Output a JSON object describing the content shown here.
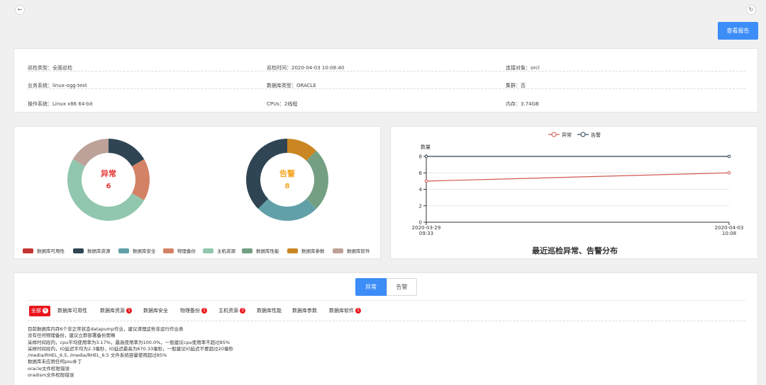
{
  "toolbar": {
    "back_icon": "arrow-left-icon",
    "refresh_icon": "refresh-icon",
    "report_button": "查看报告"
  },
  "info": {
    "rows": [
      [
        {
          "label": "巡检类型",
          "value": "全面巡检"
        },
        {
          "label": "巡检时间",
          "value": "2020-04-03 10:08:40"
        },
        {
          "label": "连接对象",
          "value": "orcl"
        }
      ],
      [
        {
          "label": "业务系统",
          "value": "linux-ogg-test"
        },
        {
          "label": "数据库类型",
          "value": "ORACLE"
        },
        {
          "label": "集群",
          "value": "否"
        }
      ],
      [
        {
          "label": "操作系统",
          "value": "Linux x86 64-bit"
        },
        {
          "label": "CPUs",
          "value": "2线程"
        },
        {
          "label": "内存",
          "value": "3.74GB"
        }
      ]
    ]
  },
  "donuts": [
    {
      "center_label": "异常",
      "center_value": "6",
      "label_color": "#e43a36",
      "segments": [
        {
          "category": "数据库资源",
          "value": 1,
          "color": "#2f4554"
        },
        {
          "category": "物理备份",
          "value": 1,
          "color": "#d48265"
        },
        {
          "category": "主机资源",
          "value": 3,
          "color": "#91c7ae"
        },
        {
          "category": "数据库软件",
          "value": 1,
          "color": "#bda29a"
        }
      ]
    },
    {
      "center_label": "告警",
      "center_value": "8",
      "label_color": "#f5a623",
      "segments": [
        {
          "category": "数据库参数",
          "value": 1,
          "color": "#ca8622"
        },
        {
          "category": "数据库性能",
          "value": 2,
          "color": "#749f83"
        },
        {
          "category": "数据库安全",
          "value": 2,
          "color": "#61a0a8"
        },
        {
          "category": "数据库资源",
          "value": 3,
          "color": "#2f4554"
        }
      ]
    }
  ],
  "legend": [
    {
      "label": "数据库可用性",
      "color": "#c23531"
    },
    {
      "label": "数据库资源",
      "color": "#2f4554"
    },
    {
      "label": "数据库安全",
      "color": "#61a0a8"
    },
    {
      "label": "物理备份",
      "color": "#d48265"
    },
    {
      "label": "主机资源",
      "color": "#91c7ae"
    },
    {
      "label": "数据库性能",
      "color": "#749f83"
    },
    {
      "label": "数据库参数",
      "color": "#ca8622"
    },
    {
      "label": "数据库软件",
      "color": "#bda29a"
    }
  ],
  "chart_data": {
    "type": "line",
    "title": "最近巡检异常、告警分布",
    "ylabel": "数量",
    "xlabel": "",
    "x": [
      "2020-03-29\n09:33",
      "2020-04-03\n10:08"
    ],
    "ylim": [
      0,
      8
    ],
    "yticks": [
      "0",
      "2",
      "4",
      "6",
      "8"
    ],
    "grid": true,
    "legend_position": "top-center",
    "series": [
      {
        "name": "异常",
        "values": [
          5,
          6
        ],
        "color": "#d0574f"
      },
      {
        "name": "告警",
        "values": [
          8,
          8
        ],
        "color": "#2f4554"
      }
    ]
  },
  "detail": {
    "tabs": [
      {
        "label": "异常",
        "active": true
      },
      {
        "label": "告警",
        "active": false
      }
    ],
    "filters": [
      {
        "label": "全部",
        "count": "6",
        "active": true
      },
      {
        "label": "数据库可用性",
        "count": "",
        "active": false
      },
      {
        "label": "数据库资源",
        "count": "1",
        "active": false
      },
      {
        "label": "数据库安全",
        "count": "",
        "active": false
      },
      {
        "label": "物理备份",
        "count": "1",
        "active": false
      },
      {
        "label": "主机资源",
        "count": "3",
        "active": false
      },
      {
        "label": "数据库性能",
        "count": "",
        "active": false
      },
      {
        "label": "数据库参数",
        "count": "",
        "active": false
      },
      {
        "label": "数据库软件",
        "count": "1",
        "active": false
      }
    ],
    "messages": [
      "目前数据库内存6个非正常状态datapump作业，建议清理这些非运行作业表",
      "没有任何物理备份，建议立即部署备份策略",
      "采样时间段内，cpu平均使用率为3.17%，最高使用率为100.0%，一般建议cpu使用率不超过85%",
      "采样时间段内，IO延迟平均为2.3毫秒，IO延迟最高为670.33毫秒，一般建议IO延迟不要超过20毫秒",
      "/media/RHEL_6.5, /media/RHEL_6.5 文件系统容量使用超过85%",
      "数据库未应用任何psu补丁",
      "oracle文件权限错误",
      "oradism文件权限错误"
    ]
  }
}
